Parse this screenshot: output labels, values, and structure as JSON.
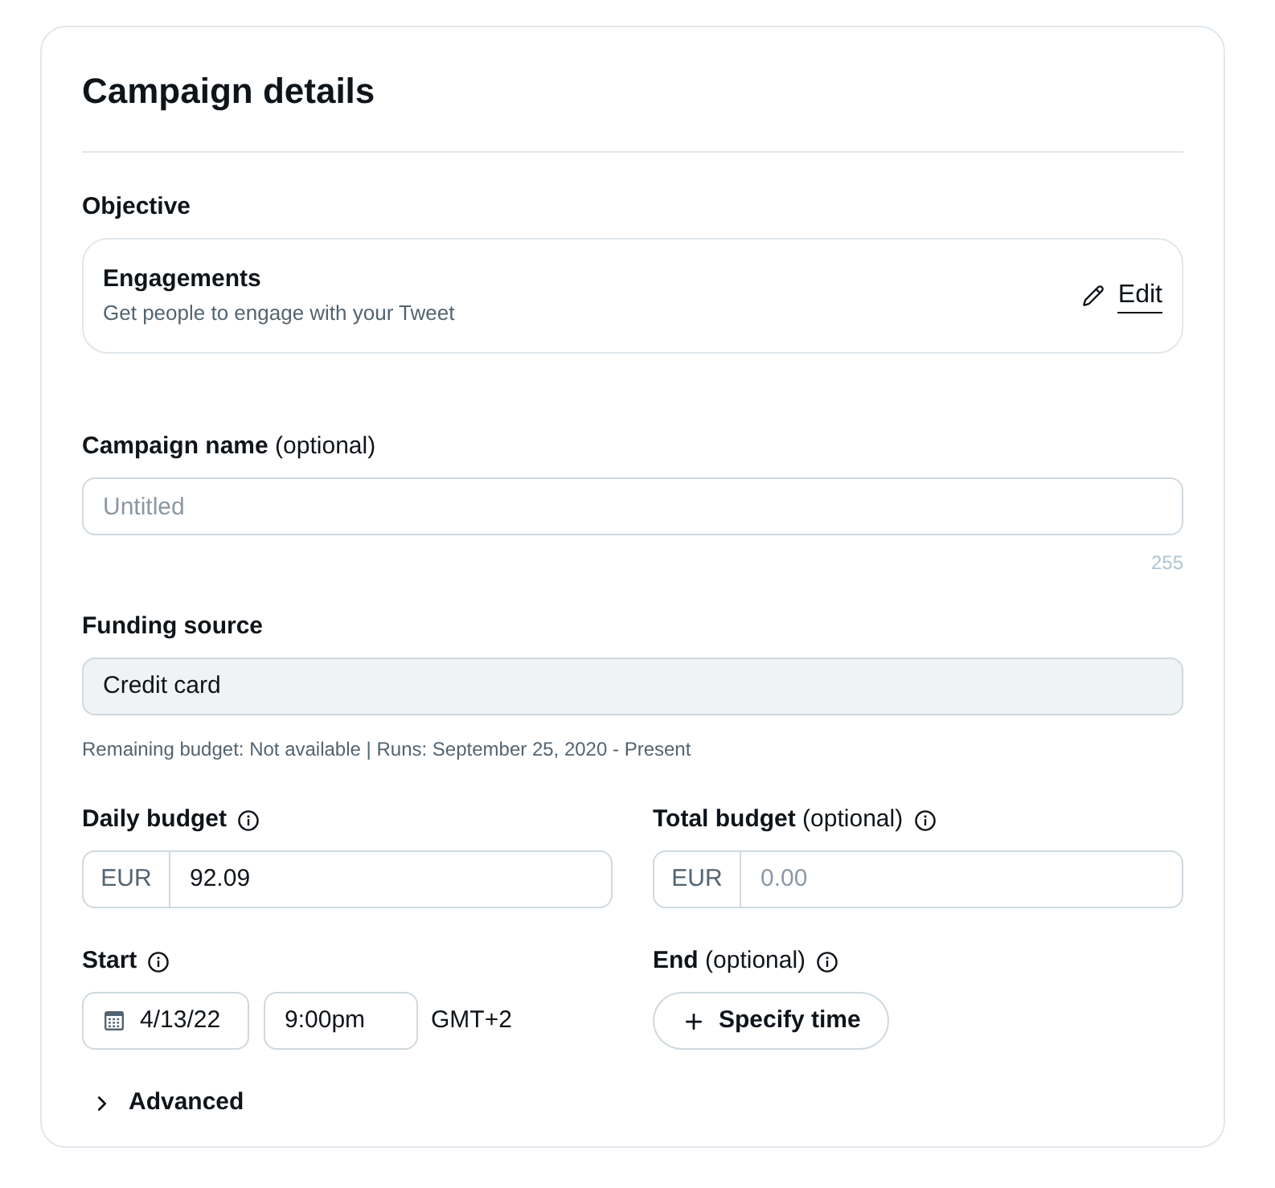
{
  "card": {
    "title": "Campaign details"
  },
  "objective": {
    "label": "Objective",
    "name": "Engagements",
    "description": "Get people to engage with your Tweet",
    "edit": "Edit"
  },
  "campaign_name": {
    "label": "Campaign name",
    "qualifier": "(optional)",
    "placeholder": "Untitled",
    "counter": "255"
  },
  "funding_source": {
    "label": "Funding source",
    "value": "Credit card",
    "disabled": true,
    "note": "Remaining budget: Not available | Runs: September 25, 2020 - Present"
  },
  "daily_budget": {
    "label": "Daily budget",
    "currency": "EUR",
    "value": "92.09"
  },
  "total_budget": {
    "label": "Total budget",
    "qualifier": "(optional)",
    "currency": "EUR",
    "placeholder": "0.00"
  },
  "start": {
    "label": "Start",
    "date": "4/13/22",
    "time": "9:00pm",
    "timezone": "GMT+2"
  },
  "end": {
    "label": "End",
    "qualifier": "(optional)",
    "button": "Specify time"
  },
  "advanced": {
    "label": "Advanced",
    "expanded": false
  }
}
